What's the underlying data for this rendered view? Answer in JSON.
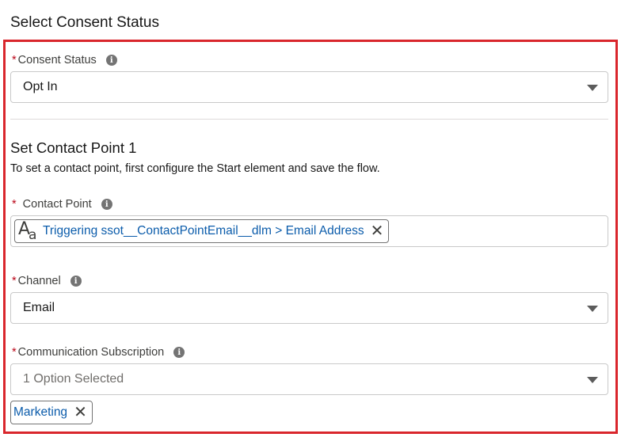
{
  "page": {
    "title": "Select Consent Status"
  },
  "consent_status": {
    "label": "Consent Status",
    "required_mark": "*",
    "value": "Opt In"
  },
  "contact_point_section": {
    "title": "Set Contact Point 1",
    "description": "To set a contact point, first configure the Start element and save the flow."
  },
  "contact_point": {
    "label": "Contact Point",
    "required_mark": "*",
    "icon_big": "A",
    "icon_small": "a",
    "pill_value": "Triggering ssot__ContactPointEmail__dlm > Email Address",
    "remove_glyph": "✕"
  },
  "channel": {
    "label": "Channel",
    "required_mark": "*",
    "value": "Email"
  },
  "communication_subscription": {
    "label": "Communication Subscription",
    "required_mark": "*",
    "value": "1 Option Selected",
    "selected_chips": [
      {
        "label": "Marketing",
        "remove_glyph": "✕"
      }
    ]
  },
  "icons": {
    "info": "i",
    "dropdown": "chevron-down-icon",
    "remove": "close-icon",
    "text_type": "text-type-icon"
  },
  "colors": {
    "highlight_border": "#d9262c",
    "required": "#ba0517",
    "link": "#0b5cab"
  }
}
